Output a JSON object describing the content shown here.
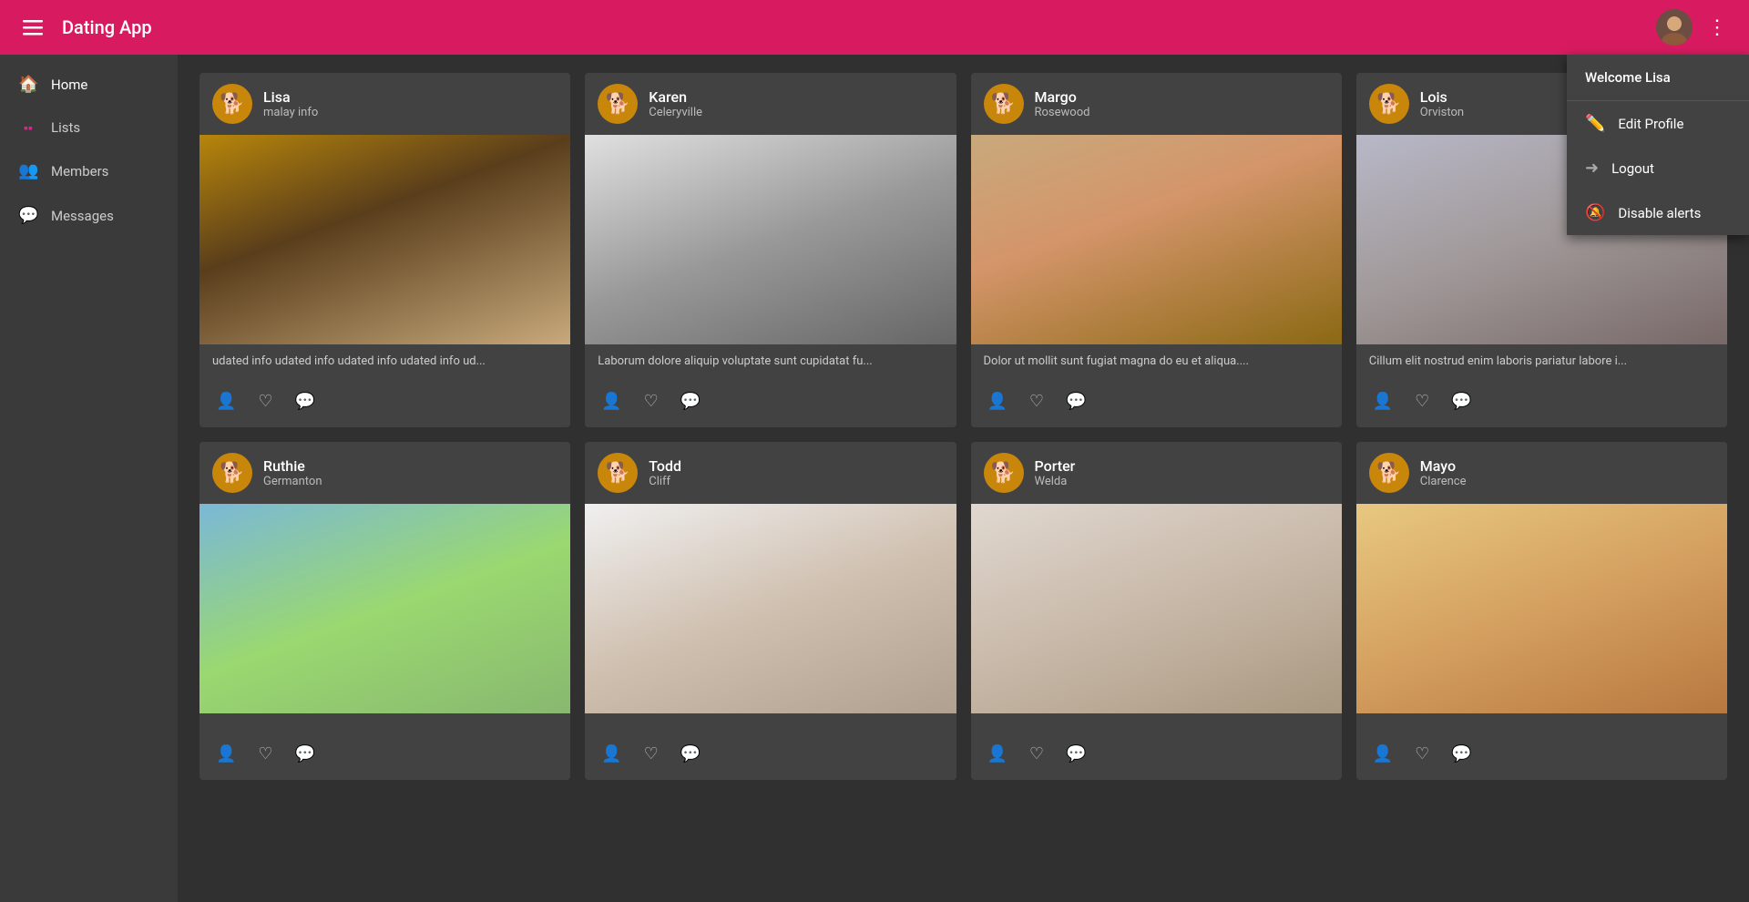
{
  "app": {
    "title": "Dating App"
  },
  "header": {
    "menu_label": "☰",
    "more_label": "⋮",
    "welcome": "Welcome Lisa"
  },
  "dropdown": {
    "welcome": "Welcome Lisa",
    "items": [
      {
        "id": "edit-profile",
        "label": "Edit Profile",
        "icon": "✏️"
      },
      {
        "id": "logout",
        "label": "Logout",
        "icon": "➜"
      },
      {
        "id": "disable-alerts",
        "label": "Disable alerts",
        "icon": "🔕"
      }
    ]
  },
  "sidebar": {
    "items": [
      {
        "id": "home",
        "label": "Home",
        "icon": "🏠"
      },
      {
        "id": "lists",
        "label": "Lists",
        "icon": "▪"
      },
      {
        "id": "members",
        "label": "Members",
        "icon": "👥"
      },
      {
        "id": "messages",
        "label": "Messages",
        "icon": "💬"
      }
    ]
  },
  "members": [
    {
      "id": "lisa",
      "name": "Lisa",
      "location": "malay info",
      "bio": "udated info udated info udated info udated info ud...",
      "photo_class": "photo-lisa"
    },
    {
      "id": "karen",
      "name": "Karen",
      "location": "Celeryville",
      "bio": "Laborum dolore aliquip voluptate sunt cupidatat fu...",
      "photo_class": "photo-karen"
    },
    {
      "id": "margo",
      "name": "Margo",
      "location": "Rosewood",
      "bio": "Dolor ut mollit sunt fugiat magna do eu et aliqua....",
      "photo_class": "photo-margo"
    },
    {
      "id": "lois",
      "name": "Lois",
      "location": "Orviston",
      "bio": "Cillum elit nostrud enim laboris pariatur labore i...",
      "photo_class": "photo-lois"
    },
    {
      "id": "ruthie",
      "name": "Ruthie",
      "location": "Germanton",
      "bio": "",
      "photo_class": "photo-ruthie"
    },
    {
      "id": "todd",
      "name": "Todd",
      "location": "Cliff",
      "bio": "",
      "photo_class": "photo-todd"
    },
    {
      "id": "porter",
      "name": "Porter",
      "location": "Welda",
      "bio": "",
      "photo_class": "photo-porter"
    },
    {
      "id": "mayo",
      "name": "Mayo",
      "location": "Clarence",
      "bio": "",
      "photo_class": "photo-mayo"
    }
  ],
  "actions": {
    "profile": "👤",
    "like": "♡",
    "message": "💬"
  }
}
